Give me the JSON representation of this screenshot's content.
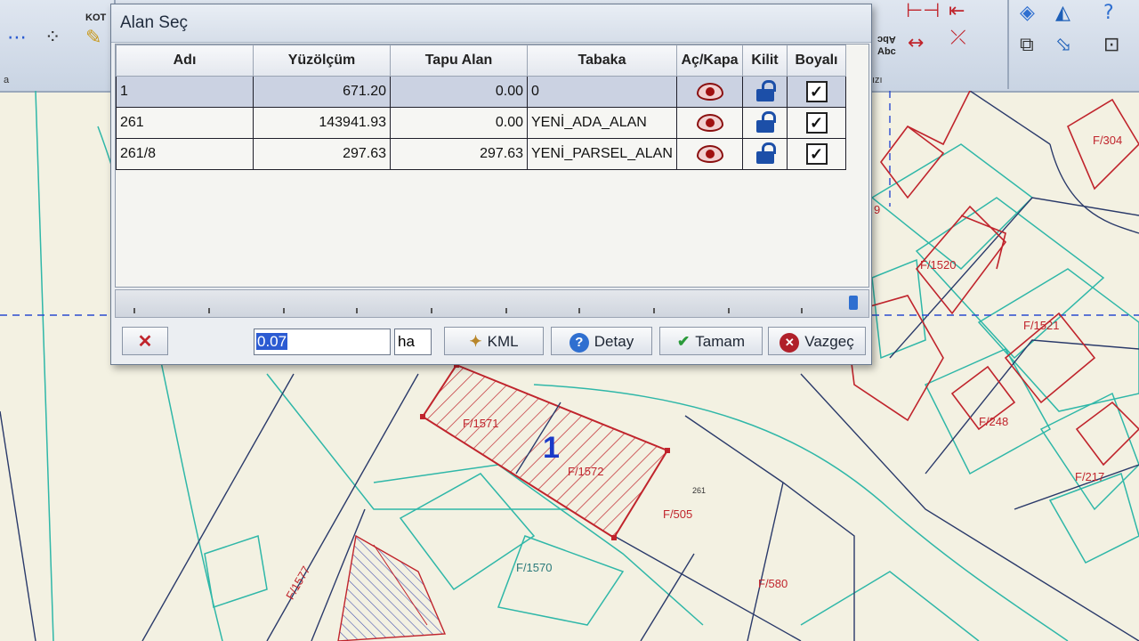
{
  "ribbon": {
    "group_label_left": "a",
    "group_label_right": "ızı",
    "labels": {
      "kot": "KOT",
      "abc_top": "Abc",
      "abc_bottom": "Abc"
    },
    "icons": [
      "dotted-line-icon",
      "grid-dots-icon",
      "pencil-icon",
      "dimension-icon",
      "text-abc-icon",
      "measure-icon",
      "snap-icon",
      "shape-select-icon",
      "help-icon"
    ]
  },
  "dialog": {
    "title": "Alan Seç",
    "columns": [
      "Adı",
      "Yüzölçüm",
      "Tapu Alan",
      "Tabaka",
      "Aç/Kapa",
      "Kilit",
      "Boyalı"
    ],
    "rows": [
      {
        "name": "1",
        "area": "671.20",
        "deed_area": "0.00",
        "layer": "0",
        "visible": true,
        "locked": false,
        "painted": true
      },
      {
        "name": "261",
        "area": "143941.93",
        "deed_area": "0.00",
        "layer": "YENİ_ADA_ALAN",
        "visible": true,
        "locked": false,
        "painted": true
      },
      {
        "name": "261/8",
        "area": "297.63",
        "deed_area": "297.63",
        "layer": "YENİ_PARSEL_ALAN",
        "visible": true,
        "locked": false,
        "painted": true
      }
    ],
    "selected_row": 0,
    "area_value": "0.07",
    "area_unit": "ha",
    "buttons": {
      "kml": "KML",
      "detail": "Detay",
      "ok": "Tamam",
      "cancel": "Vazgeç"
    }
  },
  "map": {
    "parcel_labels": [
      "F/1571",
      "F/1572",
      "F/505",
      "F/1570",
      "F/580",
      "F/1577",
      "F/1520",
      "F/1521",
      "F/248",
      "F/217",
      "F/304",
      "9"
    ],
    "selection_number": "1",
    "block_number": "261",
    "colors": {
      "background": "#f3f1e2",
      "parcel_line": "#c0242c",
      "building_line": "#2fb7a8",
      "road_line": "#2a3a6a",
      "selection": "#c0242c"
    }
  }
}
